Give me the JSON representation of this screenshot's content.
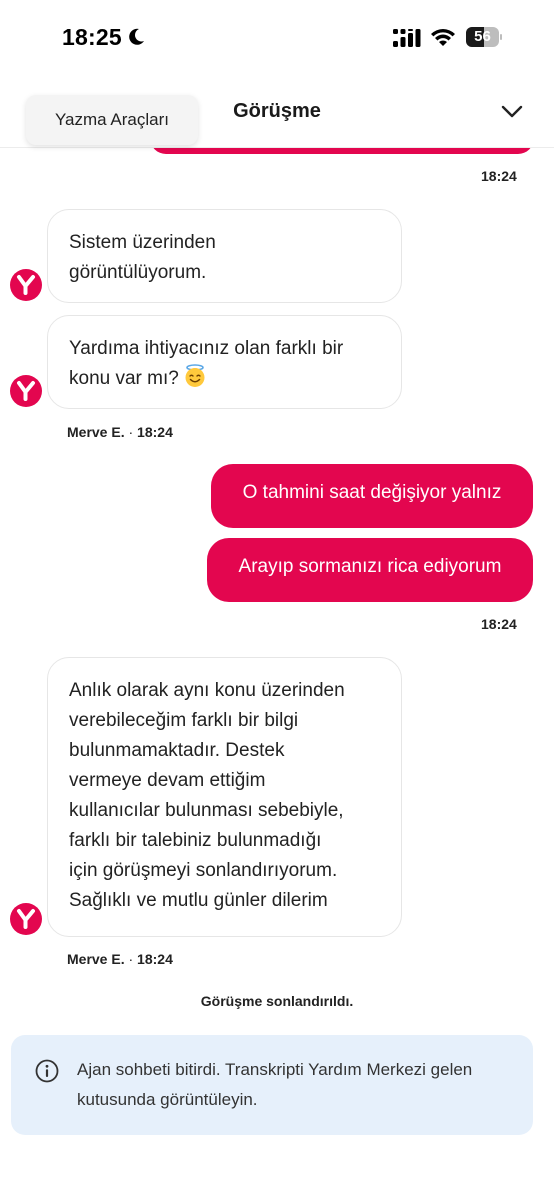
{
  "status_bar": {
    "time": "18:25",
    "battery": "56",
    "battery_level": 0.56
  },
  "header": {
    "title": "Görüşme"
  },
  "tooltip": {
    "label": "Yazma Araçları"
  },
  "messages": {
    "time_1": "18:24",
    "agent_1": "Sistem üzerinden görüntülüyorum.",
    "agent_2": "Yardıma ihtiyacınız olan farklı bir konu var mı?",
    "meta_1": {
      "name": "Merve E.",
      "sep": "·",
      "time": "18:24"
    },
    "user_1": "O tahmini saat değişiyor yalnız",
    "user_2": "Arayıp sormanızı rica ediyorum",
    "time_2": "18:24",
    "agent_3_lines": [
      "Anlık olarak aynı konu üzerinden",
      "verebileceğim farklı bir bilgi",
      "bulunmamaktadır. Destek",
      "vermeye devam ettiğim",
      "kullanıcılar bulunması sebebiyle,",
      "farklı bir talebiniz bulunmadığı",
      "için görüşmeyi sonlandırıyorum.",
      "Sağlıklı ve mutlu günler dilerim"
    ],
    "meta_2": {
      "name": "Merve E.",
      "sep": "·",
      "time": "18:24"
    }
  },
  "ended": {
    "label": "Görüşme sonlandırıldı."
  },
  "info": {
    "line_1": "Ajan sohbeti bitirdi. Transkripti Yardım Merkezi gelen",
    "line_2": "kutusunda görüntüleyin."
  },
  "icons": {
    "moon": "moon-icon",
    "signal": "signal-icon",
    "wifi": "wifi-icon",
    "chevron": "chevron-down-icon",
    "avatar": "brand-y-icon",
    "info": "info-icon",
    "emoji": "smiling-face-with-halo-emoji"
  },
  "colors": {
    "brand": "#e3064f",
    "info_bg": "#e6f0fb"
  }
}
